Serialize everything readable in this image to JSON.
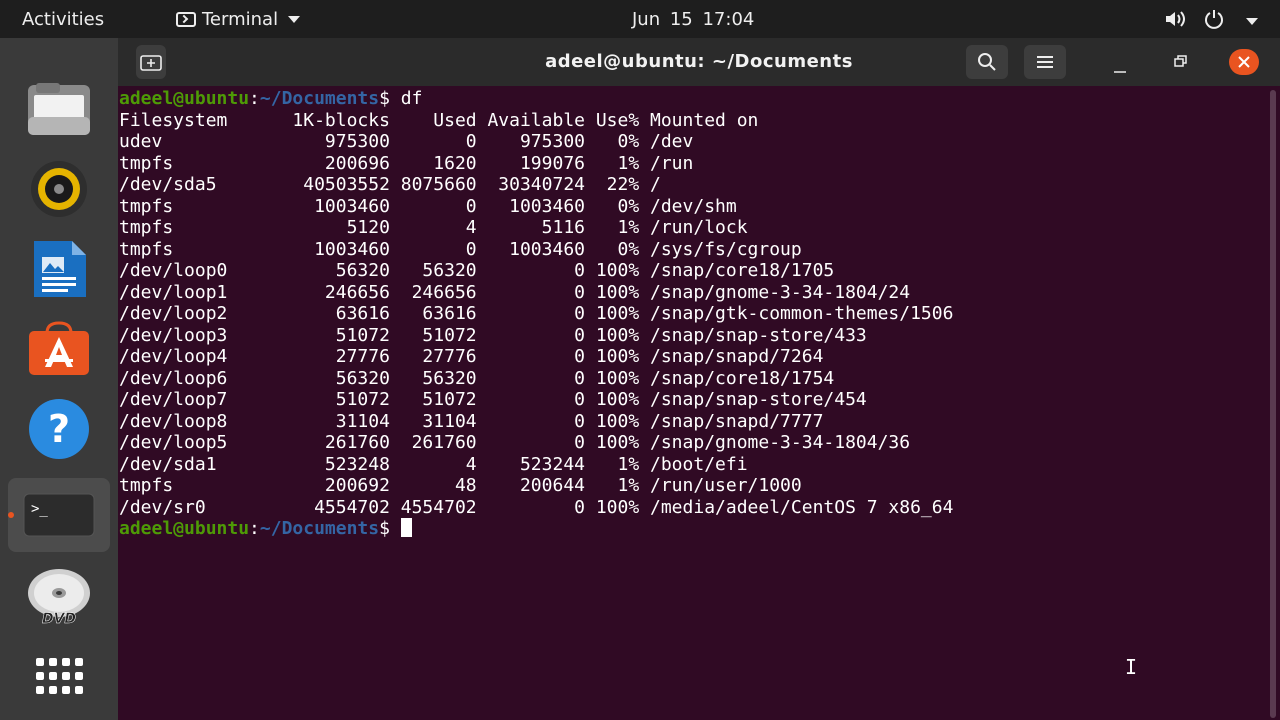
{
  "topbar": {
    "activities": "Activities",
    "app_name": "Terminal",
    "clock": "Jun 15  17:04"
  },
  "dock": {
    "items": [
      {
        "name": "files",
        "icon": "files-icon"
      },
      {
        "name": "rhythmbox",
        "icon": "speaker-icon"
      },
      {
        "name": "libreoffice-writer",
        "icon": "writer-icon"
      },
      {
        "name": "ubuntu-software",
        "icon": "software-icon"
      },
      {
        "name": "help",
        "icon": "help-icon"
      },
      {
        "name": "terminal",
        "icon": "terminal-icon",
        "active": true
      },
      {
        "name": "dvd",
        "icon": "dvd-icon"
      },
      {
        "name": "show-applications",
        "icon": "app-grid-icon"
      }
    ]
  },
  "window": {
    "title": "adeel@ubuntu: ~/Documents"
  },
  "terminal": {
    "prompt_user": "adeel@ubuntu",
    "prompt_sep": ":",
    "prompt_path": "~/Documents",
    "prompt_symbol": "$ ",
    "command": "df",
    "header": "Filesystem      1K-blocks    Used Available Use% Mounted on",
    "rows": [
      "udev               975300       0    975300   0% /dev",
      "tmpfs              200696    1620    199076   1% /run",
      "/dev/sda5        40503552 8075660  30340724  22% /",
      "tmpfs             1003460       0   1003460   0% /dev/shm",
      "tmpfs                5120       4      5116   1% /run/lock",
      "tmpfs             1003460       0   1003460   0% /sys/fs/cgroup",
      "/dev/loop0          56320   56320         0 100% /snap/core18/1705",
      "/dev/loop1         246656  246656         0 100% /snap/gnome-3-34-1804/24",
      "/dev/loop2          63616   63616         0 100% /snap/gtk-common-themes/1506",
      "/dev/loop3          51072   51072         0 100% /snap/snap-store/433",
      "/dev/loop4          27776   27776         0 100% /snap/snapd/7264",
      "/dev/loop6          56320   56320         0 100% /snap/core18/1754",
      "/dev/loop7          51072   51072         0 100% /snap/snap-store/454",
      "/dev/loop8          31104   31104         0 100% /snap/snapd/7777",
      "/dev/loop5         261760  261760         0 100% /snap/gnome-3-34-1804/36",
      "/dev/sda1          523248       4    523244   1% /boot/efi",
      "tmpfs              200692      48    200644   1% /run/user/1000",
      "/dev/sr0          4554702 4554702         0 100% /media/adeel/CentOS 7 x86_64"
    ]
  },
  "colors": {
    "terminal_bg": "#300a24",
    "prompt_user": "#4e9a06",
    "prompt_path": "#3465a4",
    "close_button": "#e95420"
  }
}
